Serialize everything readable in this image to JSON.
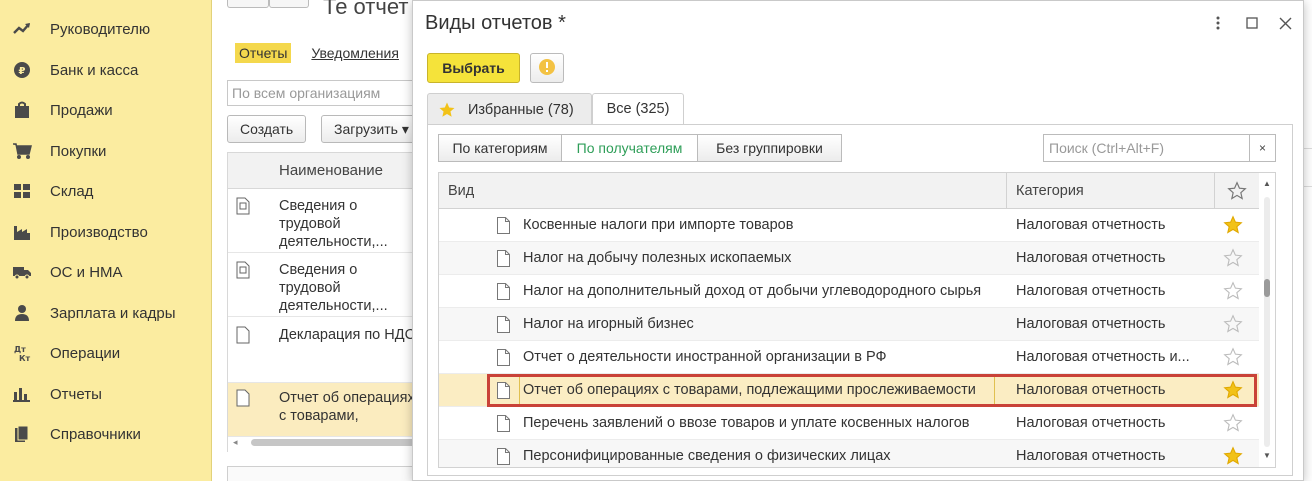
{
  "sidebar": {
    "items": [
      {
        "label": "Руководителю",
        "icon": "trend-icon"
      },
      {
        "label": "Банк и касса",
        "icon": "coin-icon"
      },
      {
        "label": "Продажи",
        "icon": "shopping-bag-icon"
      },
      {
        "label": "Покупки",
        "icon": "cart-icon"
      },
      {
        "label": "Склад",
        "icon": "warehouse-icon"
      },
      {
        "label": "Производство",
        "icon": "factory-icon"
      },
      {
        "label": "ОС и НМА",
        "icon": "truck-icon"
      },
      {
        "label": "Зарплата и кадры",
        "icon": "person-icon"
      },
      {
        "label": "Операции",
        "icon": "dt-kt-icon"
      },
      {
        "label": "Отчеты",
        "icon": "bar-chart-icon"
      },
      {
        "label": "Справочники",
        "icon": "books-icon"
      }
    ]
  },
  "background_form": {
    "title": "Те отчет",
    "tab_active": "Отчеты",
    "tab_other": "Уведомления",
    "org_filter_placeholder": "По всем организациям",
    "create_label": "Создать",
    "load_label": "Загрузить",
    "column_name": "Наименование",
    "rows": [
      [
        "Сведения о",
        "трудовой",
        "деятельности,..."
      ],
      [
        "Сведения о",
        "трудовой",
        "деятельности,..."
      ],
      [
        "Декларация по НДС"
      ],
      [
        "Отчет об операциях",
        "с товарами,"
      ]
    ]
  },
  "dialog": {
    "title": "Виды отчетов *",
    "select_label": "Выбрать",
    "tabs": [
      {
        "label": "Избранные (78)"
      },
      {
        "label": "Все (325)"
      }
    ],
    "grouping": [
      {
        "label": "По категориям",
        "active": false
      },
      {
        "label": "По получателям",
        "active": true
      },
      {
        "label": "Без группировки",
        "active": false
      }
    ],
    "search_placeholder": "Поиск (Ctrl+Alt+F)",
    "search_clear": "×",
    "columns": {
      "kind": "Вид",
      "category": "Категория"
    },
    "rows": [
      {
        "name": "Косвенные налоги при импорте товаров",
        "category": "Налоговая отчетность",
        "favorite": true
      },
      {
        "name": "Налог на добычу полезных ископаемых",
        "category": "Налоговая отчетность",
        "favorite": false
      },
      {
        "name": "Налог на дополнительный доход от добычи углеводородного сырья",
        "category": "Налоговая отчетность",
        "favorite": false
      },
      {
        "name": "Налог на игорный бизнес",
        "category": "Налоговая отчетность",
        "favorite": false
      },
      {
        "name": "Отчет о деятельности иностранной организации в РФ",
        "category": "Налоговая отчетность и...",
        "favorite": false
      },
      {
        "name": "Отчет об операциях с товарами, подлежащими прослеживаемости",
        "category": "Налоговая отчетность",
        "favorite": true,
        "selected": true
      },
      {
        "name": "Перечень заявлений о ввозе товаров и уплате косвенных налогов",
        "category": "Налоговая отчетность",
        "favorite": false
      },
      {
        "name": "Персонифицированные сведения о физических лицах",
        "category": "Налоговая отчетность",
        "favorite": true
      }
    ]
  },
  "colors": {
    "sidebar_bg": "#fbeca0",
    "select_button": "#f5e33a",
    "star_active": "#f2c218",
    "highlight_border": "#c94238",
    "active_group_text": "#2e9e58"
  }
}
